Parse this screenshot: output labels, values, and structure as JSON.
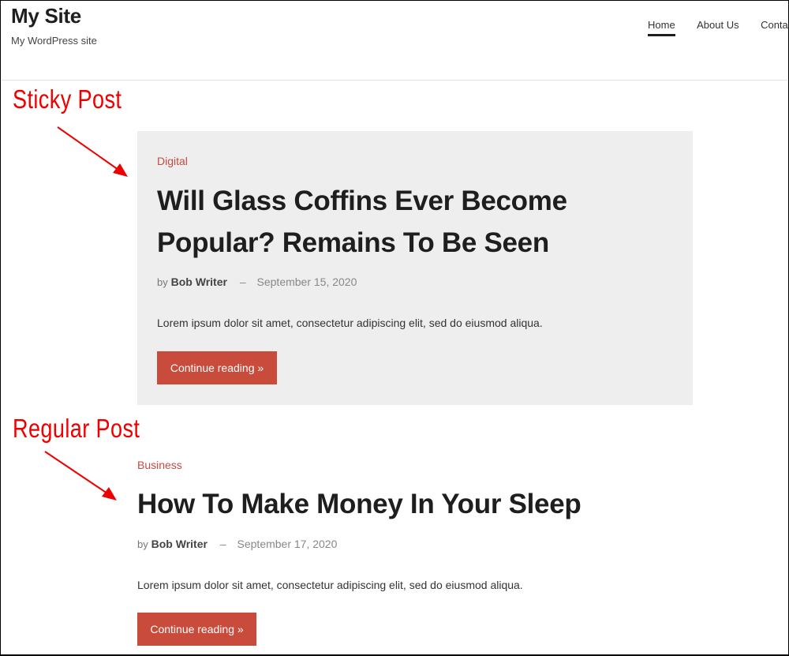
{
  "header": {
    "site_title": "My Site",
    "tagline": "My WordPress site",
    "nav": [
      {
        "label": "Home",
        "active": true
      },
      {
        "label": "About Us",
        "active": false
      },
      {
        "label": "Contact",
        "active": false
      }
    ]
  },
  "annotations": {
    "sticky_label": "Sticky Post",
    "regular_label": "Regular Post",
    "color": "#ee0000"
  },
  "posts": [
    {
      "type": "sticky",
      "category": "Digital",
      "title_line1": "Will Glass Coffins Ever Become",
      "title_line2": "Popular? Remains To Be Seen",
      "by": "by",
      "author": "Bob Writer",
      "separator": "–",
      "date": "September 15, 2020",
      "excerpt": "Lorem ipsum dolor sit amet, consectetur adipiscing elit, sed do eiusmod aliqua.",
      "button": "Continue reading »"
    },
    {
      "type": "regular",
      "category": "Business",
      "title": "How To Make Money In Your Sleep",
      "by": "by",
      "author": "Bob Writer",
      "separator": "–",
      "date": "September 17, 2020",
      "excerpt": "Lorem ipsum dolor sit amet, consectetur adipiscing elit, sed do eiusmod aliqua.",
      "button": "Continue reading »"
    }
  ],
  "colors": {
    "accent": "#c84b3c",
    "category": "#c44b42",
    "sticky_bg": "#eeeeee",
    "text": "#1e1e1e"
  }
}
